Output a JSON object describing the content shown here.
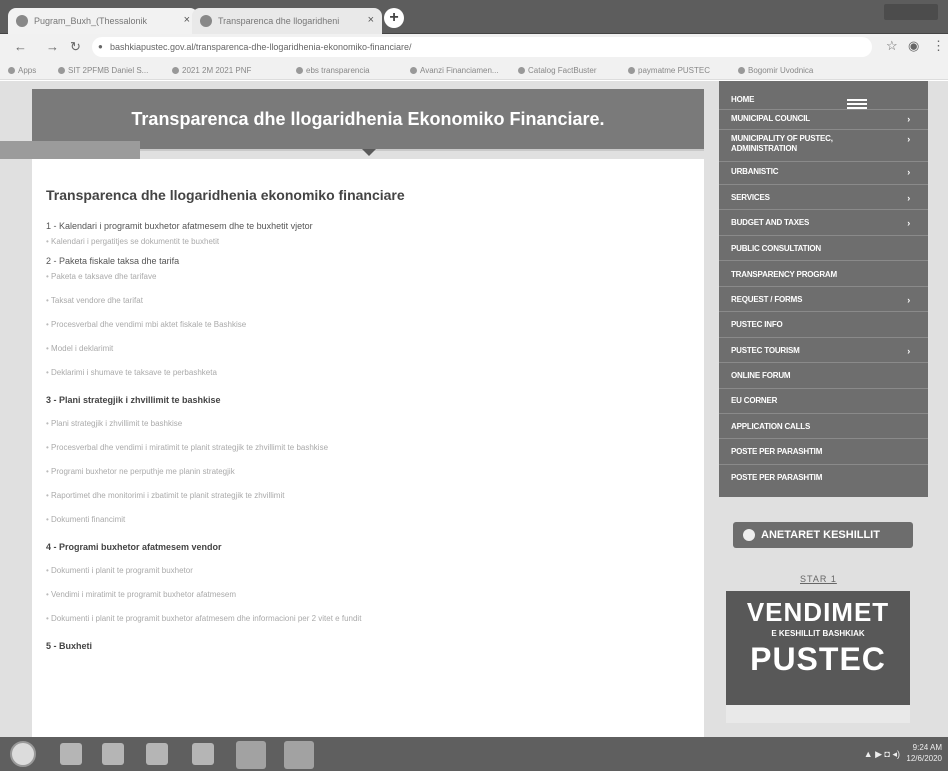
{
  "browser": {
    "tabs": [
      {
        "label": "Pugram_Buxh_(Thessalonik",
        "close": "×"
      },
      {
        "label": "Transparenca dhe llogaridheni",
        "close": "×"
      }
    ],
    "new_tab": "+",
    "address": "bashkiapustec.gov.al/transparenca-dhe-llogaridhenia-ekonomiko-financiare/",
    "bookmarks": [
      "Apps",
      "SIT 2PFMB Daniel S...",
      "2021 2M 2021 PNF",
      "ebs transparencia",
      "Avanzi Financiamen...",
      "Catalog FactBuster",
      "paymatme PUSTEC",
      "Bogomir Uvodnica"
    ]
  },
  "banner": {
    "title": "Transparenca dhe llogaridhenia Ekonomiko Financiare."
  },
  "content": {
    "heading": "Transparenca dhe llogaridhenia ekonomiko financiare",
    "sections": [
      {
        "title": "1 - Kalendari i programit buxhetor afatmesem dhe te buxhetit vjetor",
        "bullets": [
          "Kalendari i pergatitjes se dokumentit te buxhetit"
        ]
      },
      {
        "title": "2 - Paketa fiskale taksa dhe tarifa",
        "bullets": [
          "Paketa e taksave dhe tarifave",
          "Taksat vendore dhe tarifat",
          "Procesverbal dhe vendimi mbi aktet fiskale te Bashkise",
          "Model i deklarimit",
          "Deklarimi i shumave te taksave te perbashketa"
        ]
      },
      {
        "title": "3 - Plani strategjik i zhvillimit te bashkise",
        "bullets": [
          "Plani strategjik i zhvillimit te bashkise",
          "Procesverbal dhe vendimi i miratimit te planit strategjik te zhvillimit te bashkise",
          "Programi buxhetor ne perputhje me planin strategjik",
          "Raportimet dhe monitorimi i zbatimit te planit strategjik te zhvillimit",
          "Dokumenti financimit"
        ]
      },
      {
        "title": "4 - Programi buxhetor afatmesem vendor",
        "bullets": [
          "Dokumenti i planit te programit buxhetor",
          "Vendimi i miratimit te programit buxhetor afatmesem",
          "Dokumenti i planit te programit buxhetor afatmesem dhe informacioni per 2 vitet e fundit"
        ]
      },
      {
        "title": "5 - Buxheti",
        "bullets": []
      }
    ]
  },
  "sidebar": {
    "menu": [
      {
        "label": "HOME",
        "arrow": ""
      },
      {
        "label": "MUNICIPAL COUNCIL",
        "arrow": "›"
      },
      {
        "label": "MUNICIPALITY OF PUSTEC,",
        "label2": "ADMINISTRATION",
        "arrow": "›"
      },
      {
        "label": "URBANISTIC",
        "arrow": "›"
      },
      {
        "label": "SERVICES",
        "arrow": "›"
      },
      {
        "label": "BUDGET AND TAXES",
        "arrow": "›"
      },
      {
        "label": "PUBLIC CONSULTATION",
        "arrow": ""
      },
      {
        "label": "TRANSPARENCY PROGRAM",
        "arrow": ""
      },
      {
        "label": "REQUEST / FORMS",
        "arrow": "›"
      },
      {
        "label": "PUSTEC INFO",
        "arrow": ""
      },
      {
        "label": "PUSTEC TOURISM",
        "arrow": "›"
      },
      {
        "label": "ONLINE FORUM",
        "arrow": ""
      },
      {
        "label": "EU CORNER",
        "arrow": ""
      },
      {
        "label": "APPLICATION CALLS",
        "arrow": ""
      },
      {
        "label": "POSTE PER PARASHTIM",
        "arrow": ""
      },
      {
        "label": "POSTE PER PARASHTIM",
        "arrow": ""
      }
    ],
    "council_button": "ANETARET KESHILLIT",
    "star_label": "STAR 1",
    "vendimet": {
      "big": "VENDIMET",
      "sub": "E KESHILLIT BASHKIAK",
      "town": "PUSTEC"
    }
  },
  "taskbar": {
    "time": "9:24 AM",
    "date": "12/6/2020"
  }
}
